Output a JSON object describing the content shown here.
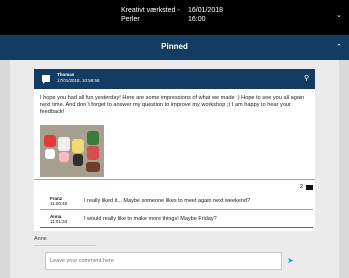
{
  "event": {
    "title": "Kreativt værksted - Perler",
    "date": "16/01/2018",
    "time": "16:00"
  },
  "pinned": {
    "label": "Pinned"
  },
  "post": {
    "author": "Thomas",
    "timestamp": "17/01/2018, 10:58:58",
    "text": "I hope you had all fun yesterday! Here are some impressions of what we made :) Hope to see you all again next time. And don´t forget to answer my question to improve my workshop ;) I am happy to hear your feedback!",
    "comment_count": "2"
  },
  "comments": [
    {
      "name": "Franz",
      "time": "11:00:45",
      "text": "I really liked it... Maybe someone likes to meet again next weekend?"
    },
    {
      "name": "Anna",
      "time": "11:01:34",
      "text": "I would really like to make more things! Maybe Friday?"
    }
  ],
  "composer": {
    "author": "Anne",
    "placeholder": "Leave your comment here"
  },
  "icons": {
    "dropdown": "chevron-down-icon",
    "collapse": "chevron-up-icon",
    "message": "chat-bubble-icon",
    "pin": "location-pin-icon",
    "comments": "comment-icon",
    "send": "send-icon"
  },
  "colors": {
    "topbar": "#000000",
    "pinned_bar": "#123c62",
    "card_header": "#133c62",
    "send": "#1e90ff"
  }
}
